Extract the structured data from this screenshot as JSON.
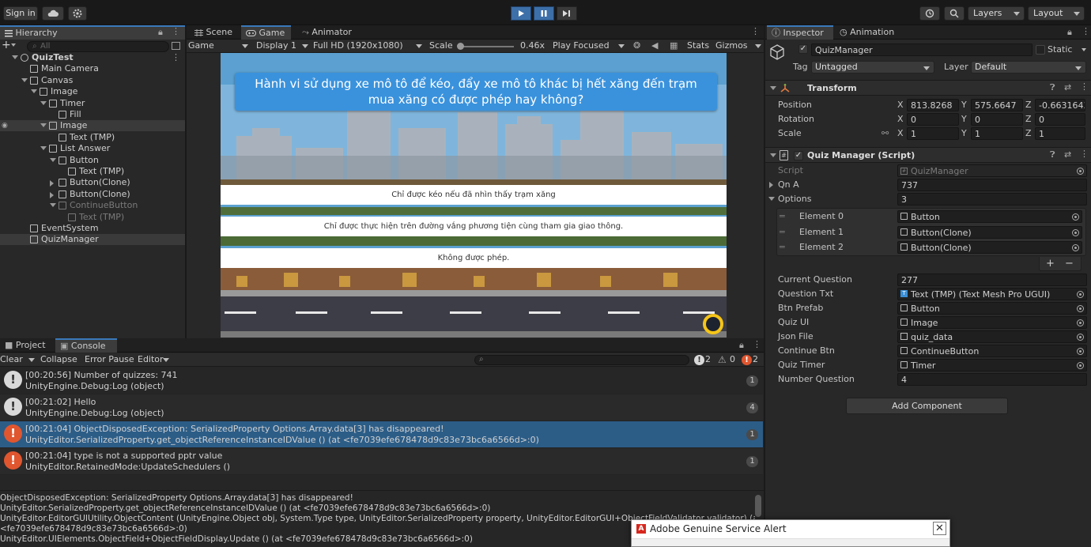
{
  "toolbar": {
    "sign_in": "Sign in",
    "layers": "Layers",
    "layout": "Layout"
  },
  "hierarchy": {
    "tab": "Hierarchy",
    "search_placeholder": "All",
    "items": [
      {
        "label": "QuizTest",
        "indent": 0,
        "dim": false
      },
      {
        "label": "Main Camera",
        "indent": 1,
        "dim": false
      },
      {
        "label": "Canvas",
        "indent": 1,
        "dim": false
      },
      {
        "label": "Image",
        "indent": 2,
        "dim": false
      },
      {
        "label": "Timer",
        "indent": 3,
        "dim": false
      },
      {
        "label": "Fill",
        "indent": 4,
        "dim": false
      },
      {
        "label": "Image",
        "indent": 3,
        "dim": false
      },
      {
        "label": "Text (TMP)",
        "indent": 4,
        "dim": false
      },
      {
        "label": "List Answer",
        "indent": 3,
        "dim": false
      },
      {
        "label": "Button",
        "indent": 4,
        "dim": false
      },
      {
        "label": "Text (TMP)",
        "indent": 5,
        "dim": false
      },
      {
        "label": "Button(Clone)",
        "indent": 4,
        "dim": false
      },
      {
        "label": "Button(Clone)",
        "indent": 4,
        "dim": false
      },
      {
        "label": "ContinueButton",
        "indent": 4,
        "dim": true
      },
      {
        "label": "Text (TMP)",
        "indent": 5,
        "dim": true
      },
      {
        "label": "EventSystem",
        "indent": 1,
        "dim": false
      },
      {
        "label": "QuizManager",
        "indent": 1,
        "dim": false
      }
    ]
  },
  "center": {
    "tabs": [
      "Scene",
      "Game",
      "Animator"
    ],
    "game_toolbar": {
      "view": "Game",
      "display": "Display 1",
      "resolution": "Full HD (1920x1080)",
      "scale_label": "Scale",
      "scale_value": "0.46x",
      "play_focused": "Play Focused",
      "stats": "Stats",
      "gizmos": "Gizmos"
    },
    "question": "Hành vi sử dụng xe mô tô để kéo, đẩy xe mô tô khác bị hết xăng đến trạm mua xăng có được phép hay không?",
    "answers": [
      "Chỉ được kéo nếu đã nhìn thấy trạm xăng",
      "Chỉ được thực hiện trên đường vắng phương tiện cùng tham gia giao thông.",
      "Không được phép."
    ]
  },
  "console": {
    "tabs": [
      "Project",
      "Console"
    ],
    "buttons": [
      "Clear",
      "Collapse",
      "Error Pause",
      "Editor"
    ],
    "counts": {
      "info": "2",
      "warn": "0",
      "error": "2"
    },
    "entries": [
      {
        "line1": "[00:20:56] Number of quizzes: 741",
        "line2": "UnityEngine.Debug:Log (object)",
        "count": "1",
        "type": "info"
      },
      {
        "line1": "[00:21:02] Hello",
        "line2": "UnityEngine.Debug:Log (object)",
        "count": "4",
        "type": "info"
      },
      {
        "line1": "[00:21:04] ObjectDisposedException: SerializedProperty Options.Array.data[3] has disappeared!",
        "line2": "UnityEditor.SerializedProperty.get_objectReferenceInstanceIDValue () (at <fe7039efe678478d9c83e73bc6a6566d>:0)",
        "count": "1",
        "type": "error"
      },
      {
        "line1": "[00:21:04] type is not a supported pptr value",
        "line2": "UnityEditor.RetainedMode:UpdateSchedulers ()",
        "count": "1",
        "type": "error"
      }
    ],
    "detail": [
      "ObjectDisposedException: SerializedProperty Options.Array.data[3] has disappeared!",
      "UnityEditor.SerializedProperty.get_objectReferenceInstanceIDValue () (at <fe7039efe678478d9c83e73bc6a6566d>:0)",
      "UnityEditor.EditorGUIUtility.ObjectContent (UnityEngine.Object obj, System.Type type, UnityEditor.SerializedProperty property, UnityEditor.EditorGUI+ObjectFieldValidator validator) (at",
      "<fe7039efe678478d9c83e73bc6a6566d>:0)",
      "UnityEditor.UIElements.ObjectField+ObjectFieldDisplay.Update () (at <fe7039efe678478d9c83e73bc6a6566d>:0)"
    ]
  },
  "inspector": {
    "tabs": [
      "Inspector",
      "Animation"
    ],
    "object_name": "QuizManager",
    "static_label": "Static",
    "tag_label": "Tag",
    "tag_value": "Untagged",
    "layer_label": "Layer",
    "layer_value": "Default",
    "transform": {
      "title": "Transform",
      "position_label": "Position",
      "rotation_label": "Rotation",
      "scale_label": "Scale",
      "position": [
        "813.8268",
        "575.6647",
        "-0.6631643"
      ],
      "rotation": [
        "0",
        "0",
        "0"
      ],
      "scale": [
        "1",
        "1",
        "1"
      ]
    },
    "script": {
      "title": "Quiz Manager (Script)",
      "script_label": "Script",
      "script_value": "QuizManager",
      "qna_label": "Qn A",
      "qna_value": "737",
      "options_label": "Options",
      "options_value": "3",
      "elements": [
        {
          "label": "Element 0",
          "value": "Button"
        },
        {
          "label": "Element 1",
          "value": "Button(Clone)"
        },
        {
          "label": "Element 2",
          "value": "Button(Clone)"
        }
      ],
      "fields": [
        {
          "label": "Current Question",
          "value": "277",
          "object": false
        },
        {
          "label": "Question Txt",
          "value": "Text (TMP) (Text Mesh Pro UGUI)",
          "object": true
        },
        {
          "label": "Btn Prefab",
          "value": "Button",
          "object": true
        },
        {
          "label": "Quiz UI",
          "value": "Image",
          "object": true
        },
        {
          "label": "Json File",
          "value": "quiz_data",
          "object": true
        },
        {
          "label": "Continue Btn",
          "value": "ContinueButton",
          "object": true
        },
        {
          "label": "Quiz Timer",
          "value": "Timer",
          "object": true
        },
        {
          "label": "Number Question",
          "value": "4",
          "object": false
        }
      ]
    },
    "add_component": "Add Component"
  },
  "alert": {
    "title": "Adobe Genuine Service Alert"
  },
  "colors": {
    "accent": "#3a79bb",
    "selected_row": "#2c5d87",
    "error": "#e0562f",
    "timer_ring": "#f5c518"
  }
}
